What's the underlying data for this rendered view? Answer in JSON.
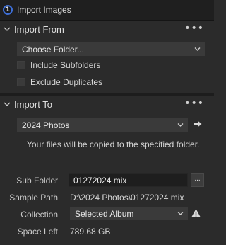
{
  "window": {
    "title": "Import Images",
    "app_icon_glyph": "1"
  },
  "import_from": {
    "title": "Import From",
    "source_dropdown": "Choose Folder...",
    "include_subfolders": {
      "label": "Include Subfolders",
      "checked": false
    },
    "exclude_duplicates": {
      "label": "Exclude Duplicates",
      "checked": false
    }
  },
  "import_to": {
    "title": "Import To",
    "destination_dropdown": "2024 Photos",
    "info": "Your files will be copied to the specified folder.",
    "sub_folder": {
      "label": "Sub Folder",
      "value": "01272024 mix",
      "browse_label": "..."
    },
    "sample_path": {
      "label": "Sample Path",
      "value": "D:\\2024 Photos\\01272024 mix"
    },
    "collection": {
      "label": "Collection",
      "value": "Selected Album"
    },
    "space_left": {
      "label": "Space Left",
      "value": "789.68 GB"
    }
  },
  "colors": {
    "accent": "#3d6fd8",
    "panel_bg": "#2b2b2b",
    "control_bg": "#3a3a3a",
    "titlebar_bg": "#1f1f1f"
  }
}
